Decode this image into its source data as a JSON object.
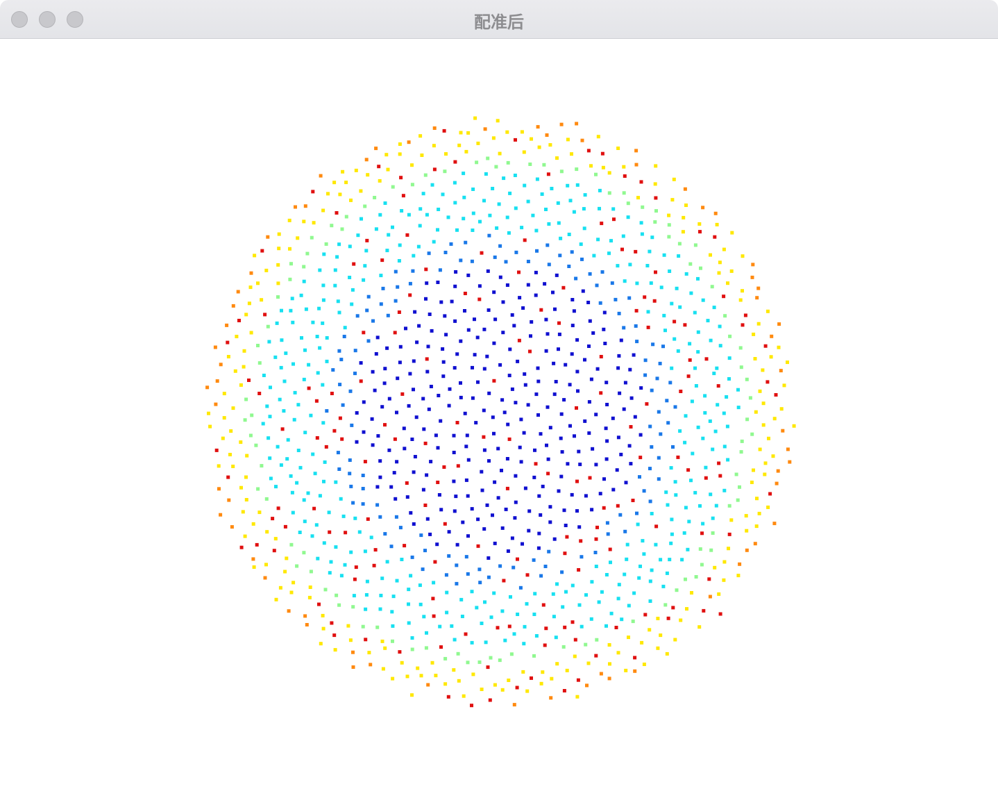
{
  "window": {
    "title": "配准后",
    "buttons": [
      "close",
      "minimize",
      "zoom"
    ],
    "background": "#ffffff"
  },
  "plot": {
    "type": "scatter",
    "description_shape": "disk",
    "colormap": "jet",
    "marker": "square",
    "colors": {
      "core": "#1010d0",
      "mid_blue": "#1a78e8",
      "cyan": "#18e0f0",
      "green": "#90f890",
      "yellow": "#ffe800",
      "orange": "#ff8a10",
      "red": "#e01010"
    },
    "point_count": 1300,
    "red_fraction": 0.12
  }
}
